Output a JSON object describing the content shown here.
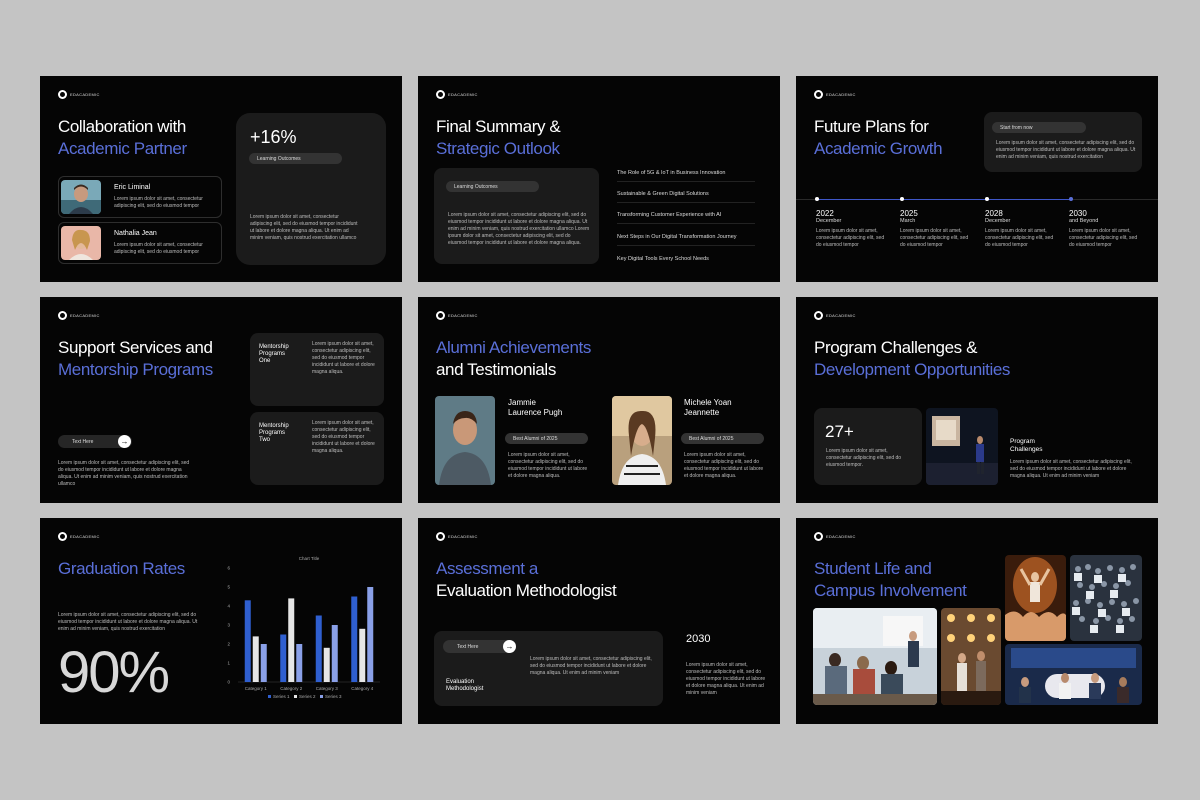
{
  "brand": "EDACADEMIC",
  "lorem_short": "Lorem ipsum dolor sit amet, consectetur adipiscing elit, sed do eiusmod tempor",
  "slide1": {
    "title1": "Collaboration with",
    "title2": "Academic Partner",
    "stat": "+16%",
    "pill": "Learning Outcomes",
    "stat_text": "Lorem ipsum dolor sit amet, consectetur adipiscing elit, sed do eiusmod tempor incididunt ut labore et dolore magna aliqua. Ut enim ad minim veniam, quis nostrud exercitation ullamco",
    "person1": {
      "name": "Eric Liminal",
      "text": "Lorem ipsum dolor sit amet, consectetur adipiscing elit, sed do eiusmod tempor"
    },
    "person2": {
      "name": "Nathalia Jean",
      "text": "Lorem ipsum dolor sit amet, consectetur adipiscing elit, sed do eiusmod tempor"
    }
  },
  "slide2": {
    "title1": "Final Summary &",
    "title2": "Strategic Outlook",
    "pill": "Learning Outcomes",
    "text": "Lorem ipsum dolor sit amet, consectetur adipiscing elit, sed do eiusmod tempor incididunt ut labore et dolore magna aliqua. Ut enim ad minim veniam, quis nostrud exercitation ullamco Lorem ipsum dolor sit amet, consectetur adipiscing elit, sed do eiusmod tempor incididunt ut labore et dolore magna aliqua.",
    "list": [
      "The Role of 5G & IoT in Business Innovation",
      "Sustainable & Green Digital Solutions",
      "Transforming Customer Experience with AI",
      "Next Steps in Our Digital Transformation Journey",
      "Key Digital Tools Every School Needs"
    ]
  },
  "slide3": {
    "title1": "Future Plans for",
    "title2": "Academic Growth",
    "pill": "Start from now",
    "card_text": "Lorem ipsum dolor sit amet, consectetur adipiscing elit, sed do eiusmod tempor incididunt ut labore et dolore magna aliqua. Ut enim ad minim veniam, quis nostrud exercitation",
    "timeline": [
      {
        "year": "2022",
        "sub": "December",
        "text": "Lorem ipsum dolor sit amet, consectetur adipiscing elit, sed do eiusmod tempor"
      },
      {
        "year": "2025",
        "sub": "March",
        "text": "Lorem ipsum dolor sit amet, consectetur adipiscing elit, sed do eiusmod tempor"
      },
      {
        "year": "2028",
        "sub": "December",
        "text": "Lorem ipsum dolor sit amet, consectetur adipiscing elit, sed do eiusmod tempor"
      },
      {
        "year": "2030",
        "sub": "and Beyond",
        "text": "Lorem ipsum dolor sit amet, consectetur adipiscing elit, sed do eiusmod tempor"
      }
    ]
  },
  "slide4": {
    "title1": "Support Services and",
    "title2": "Mentorship Programs",
    "button": "Text Here",
    "text": "Lorem ipsum dolor sit amet, consectetur adipiscing elit, sed do eiusmod tempor incididunt ut labore et dolore magna aliqua. Ut enim ad minim veniam, quis nostrud exercitation ullamco",
    "card1": {
      "label1": "Mentorship",
      "label2": "Programs",
      "label3": "One",
      "text": "Lorem ipsum dolor sit amet, consectetur adipiscing elit, sed do eiusmod tempor incididunt ut labore et dolore magna aliqua."
    },
    "card2": {
      "label1": "Mentorship",
      "label2": "Programs",
      "label3": "Two",
      "text": "Lorem ipsum dolor sit amet, consectetur adipiscing elit, sed do eiusmod tempor incididunt ut labore et dolore magna aliqua."
    }
  },
  "slide5": {
    "title1": "Alumni Achievements",
    "title2": "and Testimonials",
    "p1": {
      "name1": "Jammie",
      "name2": "Laurence Pugh",
      "pill": "Best Alumni of 2025",
      "text": "Lorem ipsum dolor sit amet, consectetur adipiscing elit, sed do eiusmod tempor incididunt ut labore et dolore magna aliqua."
    },
    "p2": {
      "name1": "Michele Yoan",
      "name2": "Jeannette",
      "pill": "Best Alumni of 2025",
      "text": "Lorem ipsum dolor sit amet, consectetur adipiscing elit, sed do eiusmod tempor incididunt ut labore et dolore magna aliqua."
    }
  },
  "slide6": {
    "title1": "Program Challenges &",
    "title2": "Development Opportunities",
    "stat": "27+",
    "stat_text": "Lorem ipsum dolor sit amet, consectetur adipiscing elit, sed do eiusmod tempor.",
    "label1": "Program",
    "label2": "Challenges",
    "text": "Lorem ipsum dolor sit amet, consectetur adipiscing elit, sed do eiusmod tempor incididunt ut labore et dolore magna aliqua. Ut enim ad minim veniam"
  },
  "slide7": {
    "title": "Graduation Rates",
    "text": "Lorem ipsum dolor sit amet, consectetur adipiscing elit, sed do eiusmod tempor incididunt ut labore et dolore magna aliqua. Ut enim ad minim veniam, quis nostrud exercitation",
    "big_stat": "90%"
  },
  "slide8": {
    "title1": "Assessment a",
    "title2": "Evaluation Methodologist",
    "button": "Text Here",
    "label1": "Evaluation",
    "label2": "Methodologist",
    "card_text": "Lorem ipsum dolor sit amet, consectetur adipiscing elit, sed do eiusmod tempor incididunt ut labore et dolore magna aliqua. Ut enim ad minim veniam",
    "year": "2030",
    "side_text": "Lorem ipsum dolor sit amet, consectetur adipiscing elit, sed do eiusmod tempor incididunt ut labore et dolore magna aliqua. Ut enim ad minim veniam"
  },
  "slide9": {
    "title1": "Student Life and",
    "title2": "Campus Involvement"
  },
  "chart_data": {
    "type": "bar",
    "title": "Chart Title",
    "categories": [
      "Category 1",
      "Category 2",
      "Category 3",
      "Category 4"
    ],
    "series": [
      {
        "name": "Series 1",
        "values": [
          4.3,
          2.5,
          3.5,
          4.5
        ],
        "color": "#2f5fd0"
      },
      {
        "name": "Series 2",
        "values": [
          2.4,
          4.4,
          1.8,
          2.8
        ],
        "color": "#e6e6e6"
      },
      {
        "name": "Series 3",
        "values": [
          2.0,
          2.0,
          3.0,
          5.0
        ],
        "color": "#8aa0e8"
      }
    ],
    "ylim": [
      0,
      6
    ],
    "yticks": [
      "0",
      "1",
      "2",
      "3",
      "4",
      "5",
      "6"
    ],
    "legend": "bottom"
  }
}
